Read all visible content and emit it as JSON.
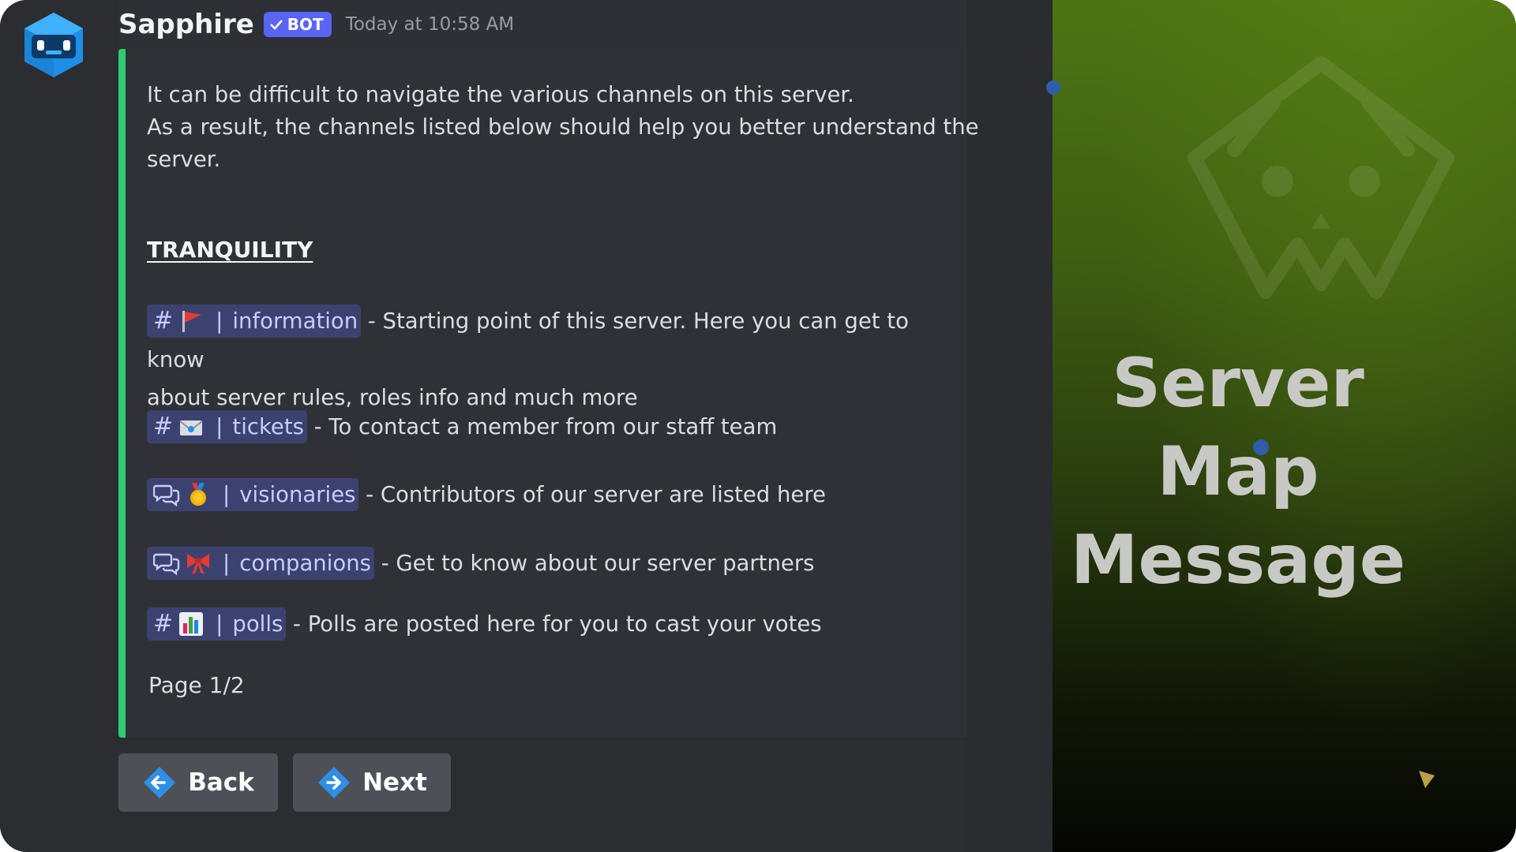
{
  "message": {
    "author": "Sapphire",
    "bot_tag": "BOT",
    "timestamp": "Today at 10:58 AM",
    "avatar_icon": "robot-avatar-icon"
  },
  "embed": {
    "accent_color": "#2ecc71",
    "intro_lines": [
      "It can be difficult to navigate the various channels on this server.",
      "As a result, the channels listed below should help you better understand the",
      "server."
    ],
    "heading": "TRANQUILITY",
    "channels": [
      {
        "icon": "hash-icon",
        "emoji": "red-flag-emoji",
        "name": "information",
        "desc_line1": " - Starting point of this server. Here you can get to know",
        "desc_line2": "about server rules, roles info and much more"
      },
      {
        "icon": "hash-icon",
        "emoji": "envelope-emoji",
        "name": "tickets",
        "desc_line1": " - To contact a member from our staff team"
      },
      {
        "icon": "forum-icon",
        "emoji": "medal-emoji",
        "name": "visionaries",
        "desc_line1": " - Contributors of our server are listed here"
      },
      {
        "icon": "forum-icon",
        "emoji": "ribbon-emoji",
        "name": "companions",
        "desc_line1": " - Get to know about our server partners"
      },
      {
        "icon": "hash-icon",
        "emoji": "bar-chart-emoji",
        "name": "polls",
        "desc_line1": " - Polls are posted here for you to cast your votes"
      }
    ],
    "channel_prefix_hash": "#",
    "channel_separator": "|",
    "footer": "Page 1/2"
  },
  "buttons": {
    "back_label": "Back",
    "next_label": "Next"
  },
  "promo": {
    "title_line1": "Server Map",
    "title_line2": "Message"
  }
}
